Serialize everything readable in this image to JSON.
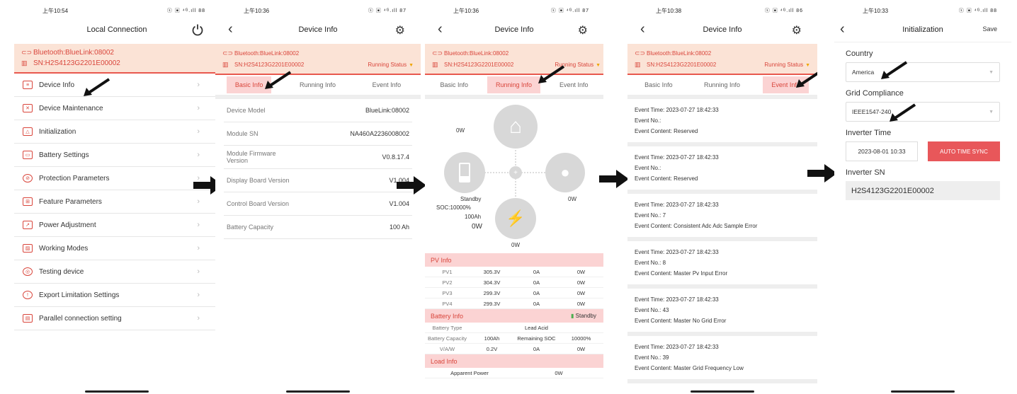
{
  "screens": {
    "s1": {
      "time": "上午10:54",
      "status_icons": "ⓢ ▣ ⁴ᴳ.ıll 88",
      "title": "Local Connection",
      "bluetooth": "Bluetooth:BlueLink:08002",
      "sn": "SN:H2S4123G2201E00002",
      "menu": [
        "Device Info",
        "Device Maintenance",
        "Initialization",
        "Battery Settings",
        "Protection Parameters",
        "Feature Parameters",
        "Power Adjustment",
        "Working Modes",
        "Testing device",
        "Export Limitation Settings",
        "Parallel connection setting"
      ]
    },
    "s2": {
      "time": "上午10:36",
      "status_icons": "ⓢ ▣ ⁴ᴳ.ıll 87",
      "title": "Device Info",
      "bluetooth": "Bluetooth:BlueLink:08002",
      "sn": "SN:H2S4123G2201E00002",
      "running_status": "Running Status",
      "tabs": [
        "Basic Info",
        "Running Info",
        "Event Info"
      ],
      "rows": [
        {
          "k": "Device Model",
          "v": "BlueLink:08002"
        },
        {
          "k": "Module SN",
          "v": "NA460A2236008002"
        },
        {
          "k": "Module Firmware Version",
          "v": "V0.8.17.4"
        },
        {
          "k": "Display Board Version",
          "v": "V1.004"
        },
        {
          "k": "Control Board Version",
          "v": "V1.004"
        },
        {
          "k": "Battery Capacity",
          "v": "100 Ah"
        }
      ]
    },
    "s3": {
      "time": "上午10:36",
      "status_icons": "ⓢ ▣ ⁴ᴳ.ıll 87",
      "title": "Device Info",
      "bluetooth": "Bluetooth:BlueLink:08002",
      "sn": "SN:H2S4123G2201E00002",
      "running_status": "Running Status",
      "tabs": [
        "Basic Info",
        "Running Info",
        "Event Info"
      ],
      "diagram": {
        "pv": "0W",
        "standby": "Standby",
        "soc": "SOC:10000%",
        "cap": "100Ah",
        "batt_w": "0W",
        "load": "0W",
        "grid": "0W"
      },
      "pv_info": "PV Info",
      "pv_rows": [
        [
          "PV1",
          "305.3V",
          "0A",
          "0W"
        ],
        [
          "PV2",
          "304.3V",
          "0A",
          "0W"
        ],
        [
          "PV3",
          "299.3V",
          "0A",
          "0W"
        ],
        [
          "PV4",
          "299.3V",
          "0A",
          "0W"
        ]
      ],
      "battery_info": "Battery Info",
      "battery_status": "Standby",
      "battery_type_k": "Battery Type",
      "battery_type_v": "Lead Acid",
      "battery_cap_row": [
        "Battery Capacity",
        "100Ah",
        "Remaining SOC",
        "10000%"
      ],
      "vaw_row": [
        "V/A/W",
        "0.2V",
        "0A",
        "0W"
      ],
      "load_info": "Load Info",
      "apparent_k": "Apparent Power",
      "apparent_v": "0W"
    },
    "s4": {
      "time": "上午10:38",
      "status_icons": "ⓢ ▣ ⁴ᴳ.ıll 86",
      "title": "Device Info",
      "bluetooth": "Bluetooth:BlueLink:08002",
      "sn": "SN:H2S4123G2201E00002",
      "running_status": "Running Status",
      "tabs": [
        "Basic Info",
        "Running Info",
        "Event Info"
      ],
      "events": [
        {
          "time": "Event Time:  2023-07-27 18:42:33",
          "no": "Event No.:",
          "content": "Event Content:  Reserved"
        },
        {
          "time": "Event Time:  2023-07-27 18:42:33",
          "no": "Event No.:",
          "content": "Event Content:  Reserved"
        },
        {
          "time": "Event Time:  2023-07-27 18:42:33",
          "no": "Event No.:  7",
          "content": "Event Content:  Consistent Adc Adc Sample Error"
        },
        {
          "time": "Event Time:  2023-07-27 18:42:33",
          "no": "Event No.:  8",
          "content": "Event Content:  Master Pv Input Error"
        },
        {
          "time": "Event Time:  2023-07-27 18:42:33",
          "no": "Event No.:  43",
          "content": "Event Content:  Master No Grid Error"
        },
        {
          "time": "Event Time:  2023-07-27 18:42:33",
          "no": "Event No.:  39",
          "content": "Event Content:  Master Grid Frequency Low"
        }
      ]
    },
    "s5": {
      "time": "上午10:33",
      "status_icons": "ⓢ ▣ ⁴ᴳ.ıll 88",
      "title": "Initialization",
      "save": "Save",
      "country_label": "Country",
      "country_value": "America",
      "grid_label": "Grid Compliance",
      "grid_value": "IEEE1547-240",
      "inverter_time_label": "Inverter Time",
      "inverter_time_value": "2023-08-01 10:33",
      "sync_label": "AUTO TIME SYNC",
      "inverter_sn_label": "Inverter SN",
      "inverter_sn_value": "H2S4123G2201E00002"
    }
  },
  "colors": {
    "accent": "#d9453b",
    "banner": "#fbe3d6",
    "tab_active": "#fbd3d3",
    "sync": "#e8575a"
  }
}
